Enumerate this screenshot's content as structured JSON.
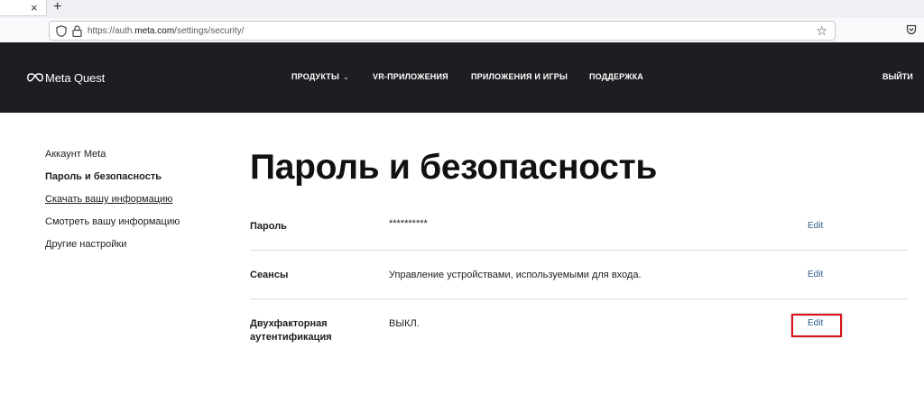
{
  "browser": {
    "tab_close_glyph": "×",
    "new_tab_glyph": "+",
    "url_scheme": "https://auth.",
    "url_host": "meta.com",
    "url_path": "/settings/security/",
    "icons": [
      "shield-icon",
      "lock-icon",
      "star-icon",
      "pocket-icon"
    ]
  },
  "header": {
    "logo_text": "Meta Quest",
    "nav": [
      {
        "label": "ПРОДУКТЫ",
        "has_dropdown": true
      },
      {
        "label": "VR-ПРИЛОЖЕНИЯ"
      },
      {
        "label": "ПРИЛОЖЕНИЯ И ИГРЫ"
      },
      {
        "label": "ПОДДЕРЖКА"
      }
    ],
    "logout": "ВЫЙТИ"
  },
  "sidebar": {
    "items": [
      {
        "label": "Аккаунт Meta"
      },
      {
        "label": "Пароль и безопасность",
        "active": true
      },
      {
        "label": "Скачать вашу информацию",
        "underlined": true
      },
      {
        "label": "Смотреть вашу информацию"
      },
      {
        "label": "Другие настройки"
      }
    ]
  },
  "main": {
    "title": "Пароль и безопасность",
    "rows": [
      {
        "label": "Пароль",
        "value": "**********",
        "action": "Edit"
      },
      {
        "label": "Сеансы",
        "value": "Управление устройствами, используемыми для входа.",
        "action": "Edit"
      },
      {
        "label_line1": "Двухфакторная",
        "label_line2": "аутентификация",
        "value": "ВЫКЛ.",
        "action": "Edit",
        "highlighted": true
      }
    ]
  },
  "colors": {
    "header_bg": "#1c1e21",
    "edit_link": "#2c5a8a",
    "highlight_border": "#d9121c"
  }
}
